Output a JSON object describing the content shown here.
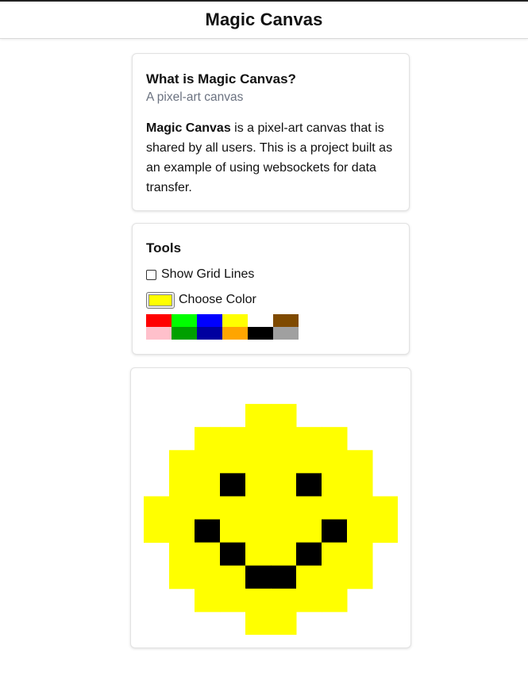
{
  "header": {
    "title": "Magic Canvas"
  },
  "about": {
    "title": "What is Magic Canvas?",
    "subtitle": "A pixel-art canvas",
    "description_bold": "Magic Canvas",
    "description_rest": " is a pixel-art canvas that is shared by all users. This is a project built as an example of using websockets for data transfer."
  },
  "tools": {
    "title": "Tools",
    "grid_lines_label": "Show Grid Lines",
    "grid_lines_checked": false,
    "choose_color_label": "Choose Color",
    "selected_color": "#ffff00",
    "palette": [
      "#ff0000",
      "#00ff00",
      "#0000ff",
      "#ffff00",
      "#ffffff",
      "#7f4a00",
      "#ffc0cb",
      "#00a000",
      "#0000a0",
      "#ffa500",
      "#000000",
      "#a0a0a0"
    ]
  },
  "canvas": {
    "colors": {
      "Y": "#ffff00",
      "K": "#000000"
    },
    "pixels": [
      "..........",
      "....YY....",
      "..YYYYYY..",
      ".YYYYYYYY.",
      ".YYKYYKYY.",
      "YYYYYYYYYY",
      "YYKYYYYKYY",
      ".YYKYYKYY.",
      ".YYYKKYYY.",
      "..YYYYYY..",
      "....YY...."
    ]
  }
}
